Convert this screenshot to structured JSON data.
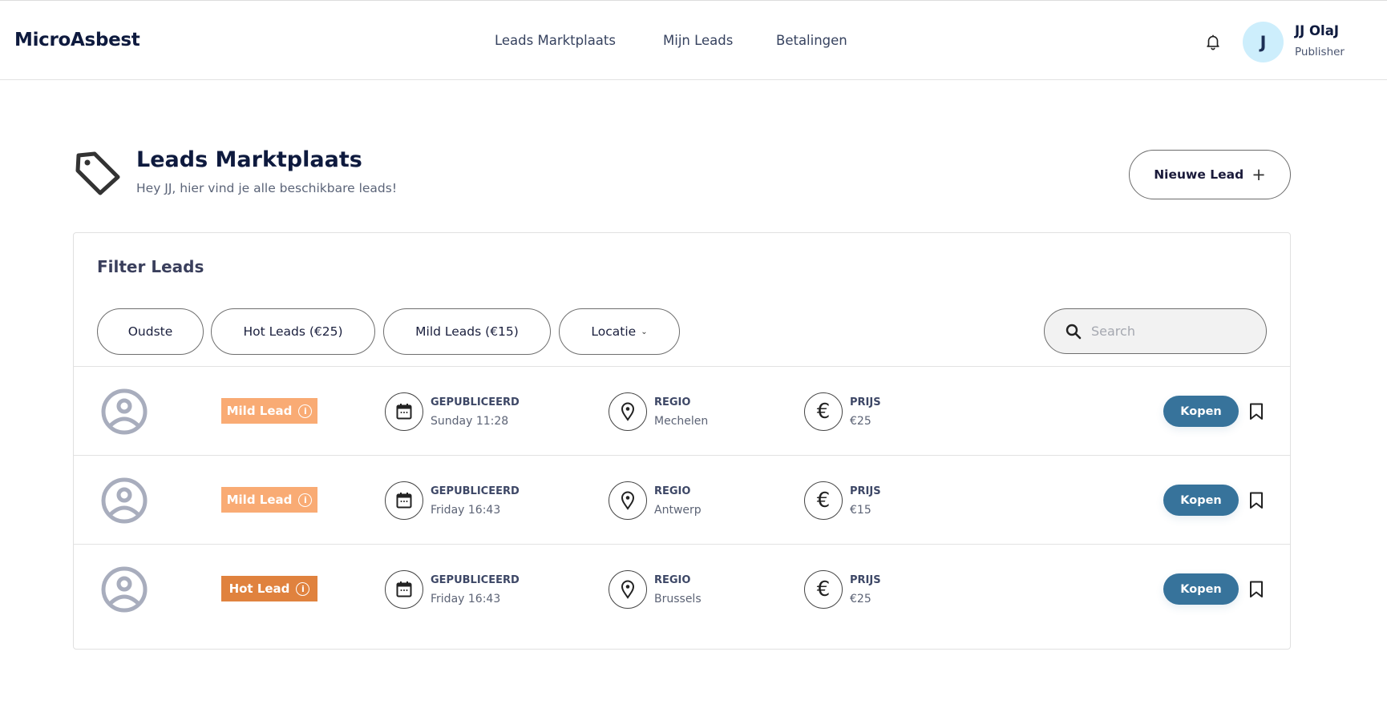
{
  "app": {
    "logo": "MicroAsbest"
  },
  "nav": {
    "items": [
      {
        "label": "Leads Marktplaats"
      },
      {
        "label": "Mijn Leads"
      },
      {
        "label": "Betalingen"
      }
    ]
  },
  "user": {
    "initial": "J",
    "name": "JJ OlaJ",
    "role": "Publisher"
  },
  "page": {
    "title": "Leads Marktplaats",
    "subtitle": "Hey JJ, hier vind je alle beschikbare leads!",
    "new_lead_label": "Nieuwe Lead",
    "new_lead_icon": "+"
  },
  "filters": {
    "title": "Filter Leads",
    "buttons": [
      {
        "label": "Oudste"
      },
      {
        "label": "Hot Leads (€25)"
      },
      {
        "label": "Mild Leads (€15)"
      },
      {
        "label": "Locatie"
      }
    ],
    "search_placeholder": "Search",
    "search_value": ""
  },
  "labels": {
    "published": "GEPUBLICEERD",
    "region": "REGIO",
    "price": "PRIJS",
    "buy": "Kopen",
    "info_glyph": "i",
    "euro_glyph": "€"
  },
  "colors": {
    "mild_lead": "#f9ab74",
    "hot_lead": "#e0823e",
    "buy_button": "#37739b",
    "avatar_bg": "#cdeefc"
  },
  "leads": [
    {
      "type": "Mild Lead",
      "kind": "mild",
      "published": "Sunday 11:28",
      "region": "Mechelen",
      "price": "€25"
    },
    {
      "type": "Mild Lead",
      "kind": "mild",
      "published": "Friday 16:43",
      "region": "Antwerp",
      "price": "€15"
    },
    {
      "type": "Hot Lead",
      "kind": "hot",
      "published": "Friday 16:43",
      "region": "Brussels",
      "price": "€25"
    }
  ]
}
